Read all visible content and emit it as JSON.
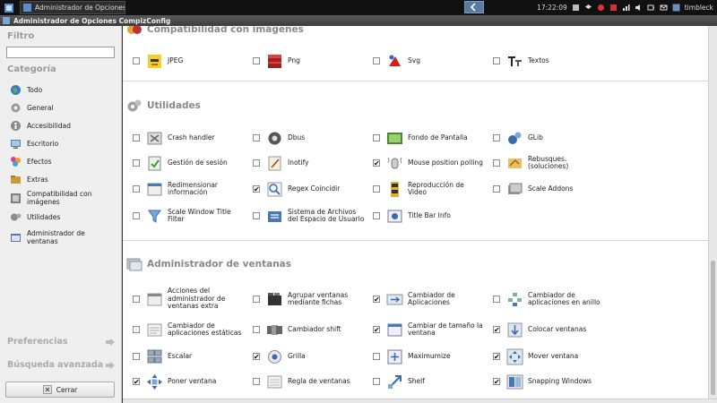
{
  "taskbar": {
    "task_title": "Administrador de Opciones...",
    "clock": "17:22:09",
    "user": "timbleck"
  },
  "window": {
    "title": "Administrador de Opciones CompizConfig"
  },
  "sidebar": {
    "filter_label": "Filtro",
    "filter_value": "",
    "category_label": "Categoría",
    "categories": [
      {
        "label": "Todo",
        "icon": "globe-icon"
      },
      {
        "label": "General",
        "icon": "gear-icon"
      },
      {
        "label": "Accesibilidad",
        "icon": "accessibility-icon"
      },
      {
        "label": "Escritorio",
        "icon": "desktop-icon"
      },
      {
        "label": "Efectos",
        "icon": "effects-icon"
      },
      {
        "label": "Extras",
        "icon": "extras-icon"
      },
      {
        "label": "Compatibilidad con imágenes",
        "icon": "image-compat-icon"
      },
      {
        "label": "Utilidades",
        "icon": "utilities-icon"
      },
      {
        "label": "Administrador de ventanas",
        "icon": "window-manager-icon"
      }
    ],
    "preferences_label": "Preferencias",
    "advanced_search_label": "Búsqueda avanzada",
    "close_label": "Cerrar"
  },
  "groups": {
    "image_compat": {
      "title": "Compatibilidad con imágenes",
      "items": [
        {
          "label": "JPEG",
          "checked": false,
          "icon": "jpeg-icon"
        },
        {
          "label": "Png",
          "checked": false,
          "icon": "png-icon"
        },
        {
          "label": "Svg",
          "checked": false,
          "icon": "svg-icon"
        },
        {
          "label": "Textos",
          "checked": false,
          "icon": "text-icon"
        }
      ]
    },
    "utilities": {
      "title": "Utilidades",
      "items": [
        {
          "label": "Crash handler",
          "checked": false,
          "icon": "crash-handler-icon"
        },
        {
          "label": "Dbus",
          "checked": false,
          "icon": "dbus-icon"
        },
        {
          "label": "Fondo de Pantalla",
          "checked": false,
          "icon": "wallpaper-icon"
        },
        {
          "label": "GLib",
          "checked": false,
          "icon": "glib-icon"
        },
        {
          "label": "Gestión de sesión",
          "checked": false,
          "icon": "session-icon"
        },
        {
          "label": "Inotify",
          "checked": false,
          "icon": "inotify-icon"
        },
        {
          "label": "Mouse position polling",
          "checked": true,
          "icon": "mouse-poll-icon"
        },
        {
          "label": "Rebusques. (soluciones)",
          "checked": false,
          "icon": "workarounds-icon"
        },
        {
          "label": "Redimensionar información",
          "checked": false,
          "icon": "resize-info-icon"
        },
        {
          "label": "Regex Coincidir",
          "checked": true,
          "icon": "regex-icon"
        },
        {
          "label": "Reproducción de Video",
          "checked": false,
          "icon": "video-icon"
        },
        {
          "label": "Scale Addons",
          "checked": false,
          "icon": "scale-addons-icon"
        },
        {
          "label": "Scale Window Title Filter",
          "checked": false,
          "icon": "title-filter-icon"
        },
        {
          "label": "Sistema de Archivos del Espacio de Usuario",
          "checked": false,
          "icon": "fuse-icon"
        },
        {
          "label": "Title Bar Info",
          "checked": false,
          "icon": "titlebar-info-icon"
        }
      ]
    },
    "window_manager": {
      "title": "Administrador de ventanas",
      "items": [
        {
          "label": "Acciones del administrador de ventanas extra",
          "checked": false,
          "icon": "extra-wm-icon"
        },
        {
          "label": "Agrupar ventanas mediante fichas",
          "checked": false,
          "icon": "group-tabs-icon"
        },
        {
          "label": "Cambiador de Aplicaciones",
          "checked": true,
          "icon": "switcher-icon"
        },
        {
          "label": "Cambiador de aplicaciones en anillo",
          "checked": false,
          "icon": "ring-switcher-icon"
        },
        {
          "label": "Cambiador de aplicaciones estáticas",
          "checked": false,
          "icon": "static-switcher-icon"
        },
        {
          "label": "Cambiador shift",
          "checked": false,
          "icon": "shift-switcher-icon"
        },
        {
          "label": "Cambiar de tamaño la ventana",
          "checked": true,
          "icon": "resize-window-icon"
        },
        {
          "label": "Colocar ventanas",
          "checked": true,
          "icon": "place-windows-icon"
        },
        {
          "label": "Escalar",
          "checked": false,
          "icon": "scale-icon"
        },
        {
          "label": "Grilla",
          "checked": true,
          "icon": "grid-icon"
        },
        {
          "label": "Maximumize",
          "checked": false,
          "icon": "maximumize-icon"
        },
        {
          "label": "Mover ventana",
          "checked": true,
          "icon": "move-window-icon"
        },
        {
          "label": "Poner ventana",
          "checked": true,
          "icon": "put-window-icon"
        },
        {
          "label": "Regla de ventanas",
          "checked": false,
          "icon": "window-rules-icon"
        },
        {
          "label": "Shelf",
          "checked": false,
          "icon": "shelf-icon"
        },
        {
          "label": "Snapping Windows",
          "checked": true,
          "icon": "snap-windows-icon"
        }
      ]
    }
  },
  "colors": {
    "panel_bg": "#efefef",
    "taskbar_bg": "#111111",
    "header_text": "#888888"
  }
}
